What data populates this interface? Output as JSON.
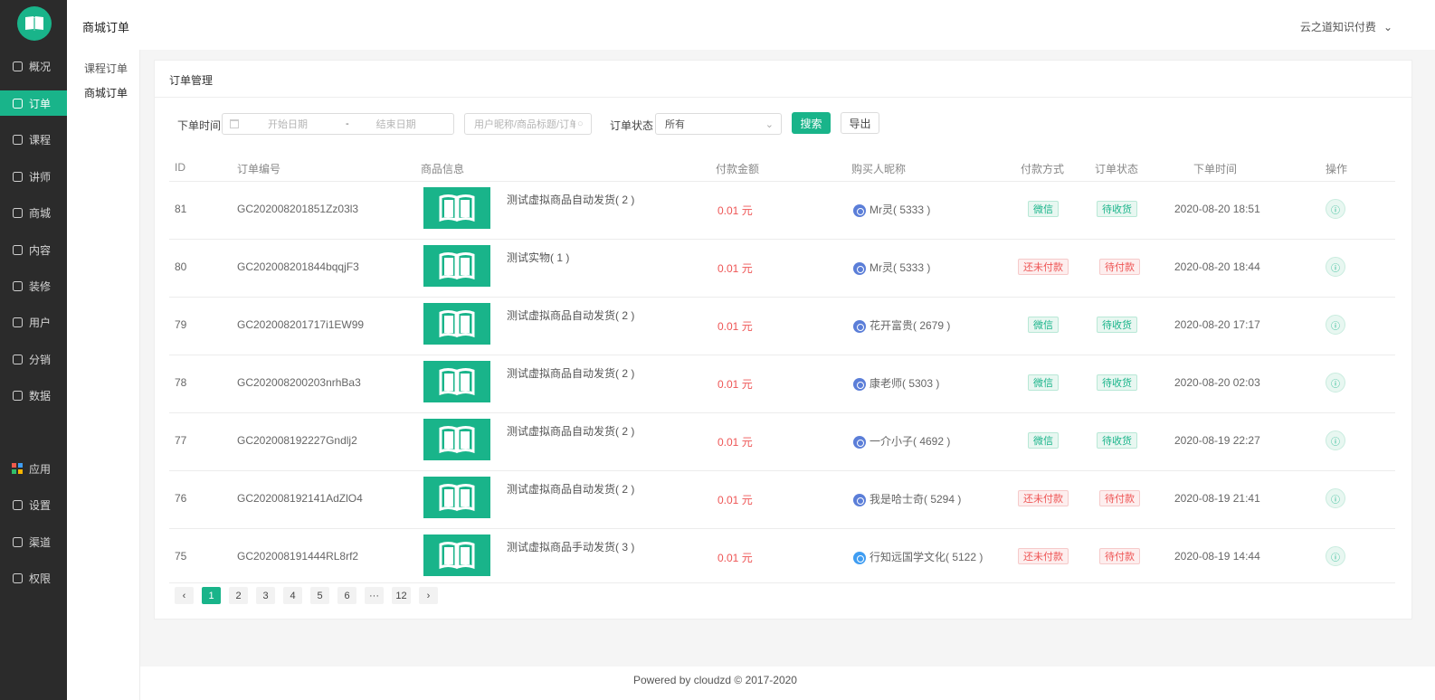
{
  "colors": {
    "accent": "#19b48a",
    "sidebar_bg": "#2b2b2b",
    "price": "#ee5555"
  },
  "sidebar": {
    "logo_icon": "book-icon",
    "items": [
      {
        "label": "概况",
        "icon": "home-icon"
      },
      {
        "label": "订单",
        "icon": "order-icon",
        "active": true
      },
      {
        "label": "课程",
        "icon": "course-icon"
      },
      {
        "label": "讲师",
        "icon": "teacher-icon"
      },
      {
        "label": "商城",
        "icon": "shop-icon"
      },
      {
        "label": "内容",
        "icon": "content-icon"
      },
      {
        "label": "装修",
        "icon": "decorate-icon"
      },
      {
        "label": "用户",
        "icon": "user-icon"
      },
      {
        "label": "分销",
        "icon": "distribution-icon"
      },
      {
        "label": "数据",
        "icon": "data-icon"
      },
      {
        "label": "应用",
        "icon": "apps-icon"
      },
      {
        "label": "设置",
        "icon": "settings-icon"
      },
      {
        "label": "渠道",
        "icon": "channel-icon"
      },
      {
        "label": "权限",
        "icon": "permission-icon"
      }
    ]
  },
  "subnav": {
    "items": [
      "课程订单",
      "商城订单"
    ]
  },
  "header": {
    "title": "商城订单",
    "user_menu": "云之道知识付费"
  },
  "panel": {
    "title": "订单管理"
  },
  "filters": {
    "time_label": "下单时间",
    "start_placeholder": "开始日期",
    "date_separator": "-",
    "end_placeholder": "结束日期",
    "search_placeholder": "用户昵称/商品标题/订单",
    "status_label": "订单状态",
    "status_value": "所有",
    "search_button": "搜索",
    "export_button": "导出"
  },
  "table": {
    "headers": [
      "ID",
      "订单编号",
      "商品信息",
      "付款金额",
      "购买人昵称",
      "付款方式",
      "订单状态",
      "下单时间",
      "操作"
    ],
    "rows": [
      {
        "id": "81",
        "order_no": "GC202008201851Zz03l3",
        "product": "测试虚拟商品自动发货( 2 )",
        "amount": "0.01 元",
        "buyer": "Mr灵( 5333 )",
        "payment": "微信",
        "payment_type": "green",
        "status": "待收货",
        "status_type": "green",
        "time": "2020-08-20 18:51"
      },
      {
        "id": "80",
        "order_no": "GC202008201844bqqjF3",
        "product": "测试实物( 1 )",
        "amount": "0.01 元",
        "buyer": "Mr灵( 5333 )",
        "payment": "还未付款",
        "payment_type": "red",
        "status": "待付款",
        "status_type": "red",
        "time": "2020-08-20 18:44"
      },
      {
        "id": "79",
        "order_no": "GC202008201717i1EW99",
        "product": "测试虚拟商品自动发货( 2 )",
        "amount": "0.01 元",
        "buyer": "花开富贵( 2679 )",
        "payment": "微信",
        "payment_type": "green",
        "status": "待收货",
        "status_type": "green",
        "time": "2020-08-20 17:17"
      },
      {
        "id": "78",
        "order_no": "GC202008200203nrhBa3",
        "product": "测试虚拟商品自动发货( 2 )",
        "amount": "0.01 元",
        "buyer": "康老师( 5303 )",
        "payment": "微信",
        "payment_type": "green",
        "status": "待收货",
        "status_type": "green",
        "time": "2020-08-20 02:03"
      },
      {
        "id": "77",
        "order_no": "GC202008192227Gndlj2",
        "product": "测试虚拟商品自动发货( 2 )",
        "amount": "0.01 元",
        "buyer": "一介小子( 4692 )",
        "payment": "微信",
        "payment_type": "green",
        "status": "待收货",
        "status_type": "green",
        "time": "2020-08-19 22:27"
      },
      {
        "id": "76",
        "order_no": "GC202008192141AdZlO4",
        "product": "测试虚拟商品自动发货( 2 )",
        "amount": "0.01 元",
        "buyer": "我是哈士奇( 5294 )",
        "payment": "还未付款",
        "payment_type": "red",
        "status": "待付款",
        "status_type": "red",
        "time": "2020-08-19 21:41"
      },
      {
        "id": "75",
        "order_no": "GC202008191444RL8rf2",
        "product": "测试虚拟商品手动发货( 3 )",
        "amount": "0.01 元",
        "buyer": "行知远国学文化( 5122 )",
        "payment": "还未付款",
        "payment_type": "red",
        "status": "待付款",
        "status_type": "red",
        "time": "2020-08-19 14:44"
      }
    ]
  },
  "pagination": {
    "prev": "‹",
    "pages": [
      "1",
      "2",
      "3",
      "4",
      "5",
      "6",
      "···",
      "12"
    ],
    "current": "1",
    "next": "›"
  },
  "footer": {
    "text": "Powered by cloudzd © 2017-2020"
  }
}
